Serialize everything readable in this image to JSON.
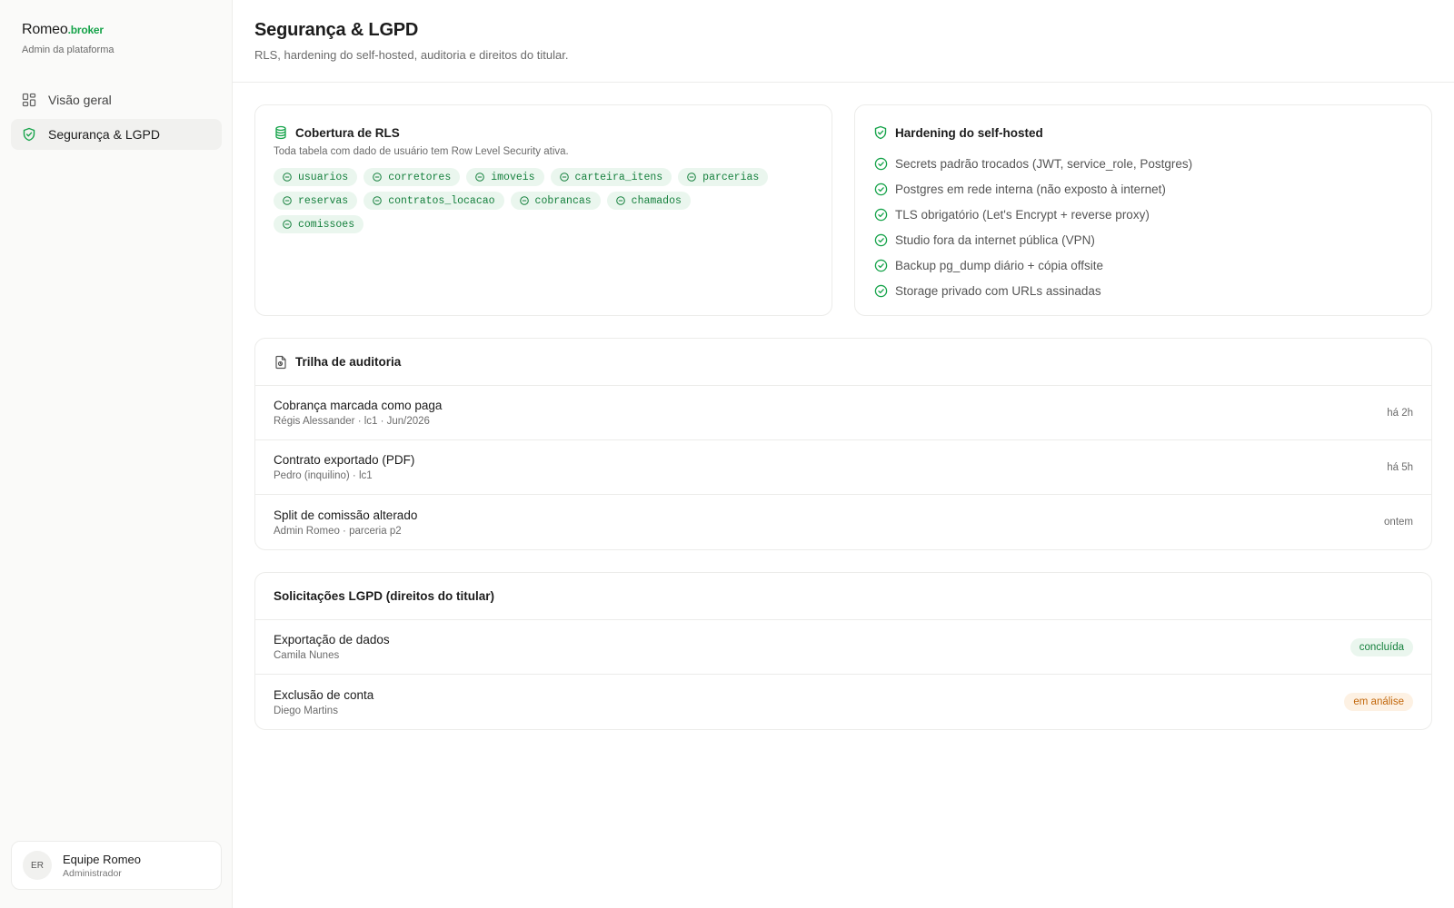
{
  "brand": {
    "name": "Romeo",
    "suffix": ".broker",
    "subtitle": "Admin da plataforma"
  },
  "nav": [
    {
      "label": "Visão geral",
      "icon": "dashboard-grid-icon",
      "active": false
    },
    {
      "label": "Segurança & LGPD",
      "icon": "shield-check-icon",
      "active": true
    }
  ],
  "user": {
    "initials": "ER",
    "name": "Equipe Romeo",
    "role": "Administrador"
  },
  "header": {
    "title": "Segurança & LGPD",
    "subtitle": "RLS, hardening do self-hosted, auditoria e direitos do titular."
  },
  "rls": {
    "title": "Cobertura de RLS",
    "description": "Toda tabela com dado de usuário tem Row Level Security ativa.",
    "tables": [
      "usuarios",
      "corretores",
      "imoveis",
      "carteira_itens",
      "parcerias",
      "reservas",
      "contratos_locacao",
      "cobrancas",
      "chamados",
      "comissoes"
    ]
  },
  "hardening": {
    "title": "Hardening do self-hosted",
    "items": [
      "Secrets padrão trocados (JWT, service_role, Postgres)",
      "Postgres em rede interna (não exposto à internet)",
      "TLS obrigatório (Let's Encrypt + reverse proxy)",
      "Studio fora da internet pública (VPN)",
      "Backup pg_dump diário + cópia offsite",
      "Storage privado com URLs assinadas"
    ]
  },
  "audit": {
    "title": "Trilha de auditoria",
    "rows": [
      {
        "title": "Cobrança marcada como paga",
        "meta": "Régis Alessander · lc1 · Jun/2026",
        "time": "há 2h"
      },
      {
        "title": "Contrato exportado (PDF)",
        "meta": "Pedro (inquilino) · lc1",
        "time": "há 5h"
      },
      {
        "title": "Split de comissão alterado",
        "meta": "Admin Romeo · parceria p2",
        "time": "ontem"
      }
    ]
  },
  "lgpd": {
    "title": "Solicitações LGPD (direitos do titular)",
    "rows": [
      {
        "title": "Exportação de dados",
        "meta": "Camila Nunes",
        "status": "concluída",
        "status_type": "done"
      },
      {
        "title": "Exclusão de conta",
        "meta": "Diego Martins",
        "status": "em análise",
        "status_type": "review"
      }
    ]
  },
  "colors": {
    "accent": "#16a34a",
    "accent_bg": "#eaf6ee",
    "warning": "#c2670a",
    "warning_bg": "#fdf1e3"
  }
}
